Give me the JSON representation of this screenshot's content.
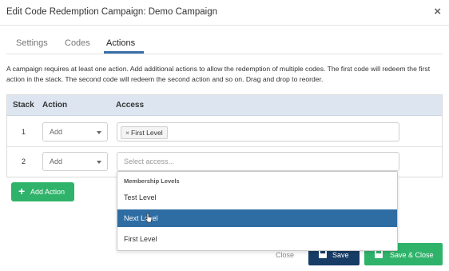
{
  "modal": {
    "title": "Edit Code Redemption Campaign: Demo Campaign",
    "close_glyph": "×"
  },
  "tabs": [
    {
      "label": "Settings",
      "active": false
    },
    {
      "label": "Codes",
      "active": false
    },
    {
      "label": "Actions",
      "active": true
    }
  ],
  "description": "A campaign requires at least one action. Add additional actions to allow the redemption of multiple codes. The first code will redeem the first action in the stack. The second code will redeem the second action and so on. Drag and drop to reorder.",
  "table": {
    "headers": [
      "Stack",
      "Action",
      "Access"
    ],
    "rows": [
      {
        "stack": "1",
        "action": "Add",
        "access_tags": [
          "First Level"
        ],
        "access_placeholder": ""
      },
      {
        "stack": "2",
        "action": "Add",
        "access_tags": [],
        "access_placeholder": "Select access..."
      }
    ]
  },
  "add_action_button": {
    "icon": "plus-icon",
    "plus_glyph": "+",
    "label": "Add Action"
  },
  "dropdown": {
    "group_label": "Membership Levels",
    "options": [
      {
        "label": "Test Level",
        "highlighted": false
      },
      {
        "label": "Next Level",
        "highlighted": true
      },
      {
        "label": "First Level",
        "highlighted": false
      }
    ]
  },
  "footer": {
    "close_label": "Close",
    "save_label": "Save",
    "save_close_label": "Save & Close",
    "save_icon": "floppy-disk-icon"
  },
  "colors": {
    "accent_blue": "#2e6da4",
    "save_navy": "#173c66",
    "green": "#2fb36a",
    "table_header": "#dde6f0"
  }
}
